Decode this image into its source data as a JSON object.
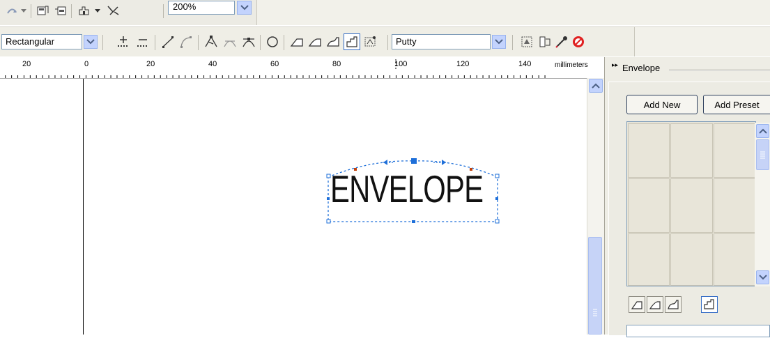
{
  "toolbar_top": {
    "zoom_value": "200%",
    "icons": [
      "rotate-icon",
      "dropdown-arrow-icon",
      "import-icon",
      "export-icon",
      "application-launcher-icon",
      "dropdown-arrow-icon",
      "symbol-icon"
    ]
  },
  "property_bar": {
    "selection_mode": "Rectangular",
    "envelope_mode": "Putty",
    "icons": [
      "add-node-icon",
      "delete-node-icon",
      "to-line-icon",
      "to-curve-icon",
      "cusp-node-icon",
      "smooth-node-icon",
      "symmetrical-node-icon",
      "add-preset-icon",
      "straight-line-mode-icon",
      "single-arc-mode-icon",
      "double-arc-mode-icon",
      "unconstrained-mode-icon",
      "add-new-envelope-icon",
      "copy-properties-icon",
      "create-from-icon",
      "eyedropper-icon",
      "clear-envelope-icon"
    ]
  },
  "ruler": {
    "labels": [
      "20",
      "0",
      "20",
      "40",
      "60",
      "80",
      "100",
      "120",
      "140"
    ],
    "unit": "millimeters"
  },
  "canvas": {
    "text": "ENVELOPE"
  },
  "docker": {
    "title": "Envelope",
    "add_new_label": "Add New",
    "add_preset_label": "Add Preset",
    "colors": {
      "panel": "#eeede5",
      "cell": "#e8e5d9"
    }
  },
  "colors": {
    "accent": "#316ac5",
    "selection_handles": "#1e6fd9",
    "scroll_blue": "#c3d3fd"
  }
}
